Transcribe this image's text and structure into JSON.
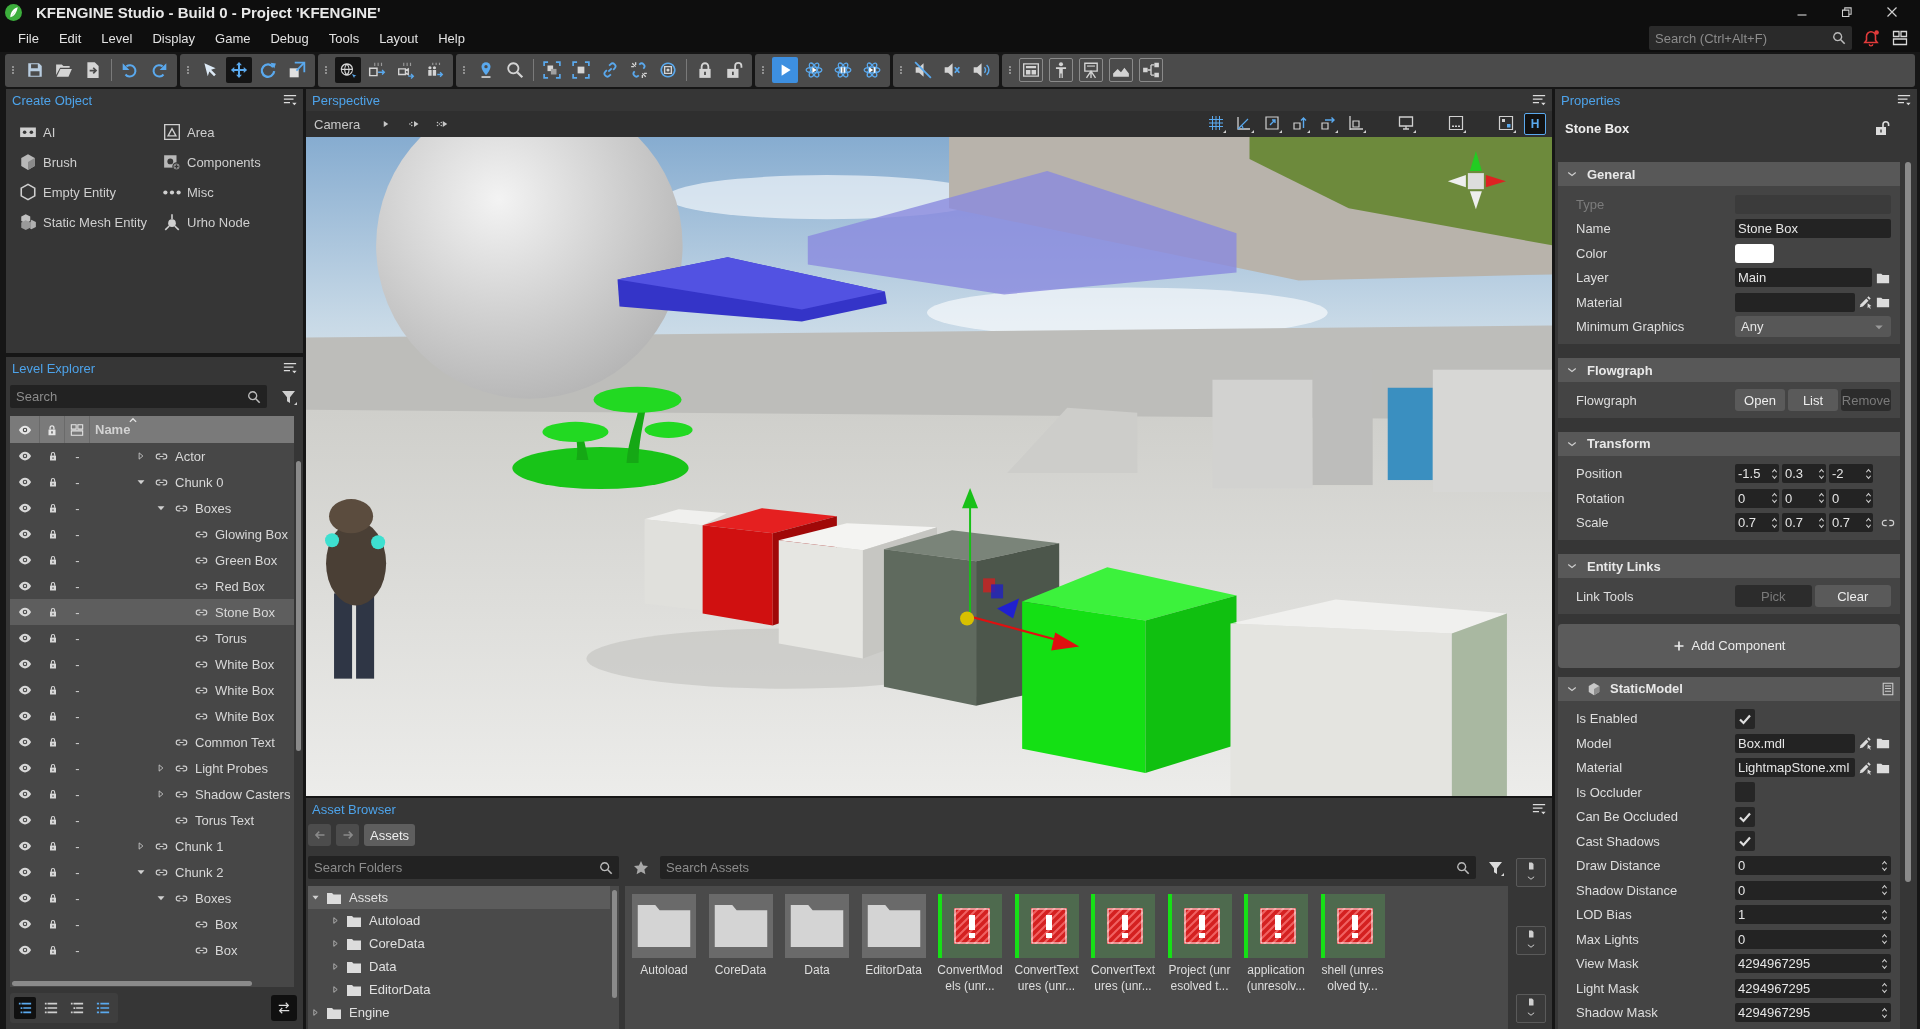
{
  "window": {
    "title": "KFENGINE Studio - Build 0 - Project 'KFENGINE'"
  },
  "menu": [
    {
      "label": "File"
    },
    {
      "label": "Edit"
    },
    {
      "label": "Level"
    },
    {
      "label": "Display"
    },
    {
      "label": "Game"
    },
    {
      "label": "Debug"
    },
    {
      "label": "Tools"
    },
    {
      "label": "Layout"
    },
    {
      "label": "Help"
    }
  ],
  "global_search": {
    "placeholder": "Search (Ctrl+Alt+F)"
  },
  "toolbar": [
    {
      "kind": "tools",
      "sections": [
        [
          {
            "kind": "save",
            "selected": false
          },
          {
            "kind": "open",
            "selected": false
          },
          {
            "kind": "export",
            "selected": false
          }
        ],
        [
          {
            "kind": "undo",
            "selected": false
          },
          {
            "kind": "redo",
            "selected": false
          }
        ]
      ]
    },
    {
      "kind": "tools",
      "sections": [
        [
          {
            "kind": "select",
            "selected": false
          },
          {
            "kind": "move",
            "selected": true
          },
          {
            "kind": "rotate",
            "selected": false
          },
          {
            "kind": "scale",
            "selected": false
          }
        ]
      ]
    },
    {
      "kind": "tools",
      "sections": [
        [
          {
            "kind": "world",
            "selected": true
          },
          {
            "kind": "snap-box",
            "selected": false
          },
          {
            "kind": "snap-camera",
            "selected": false
          },
          {
            "kind": "snap-people",
            "selected": false
          }
        ]
      ]
    },
    {
      "kind": "tools",
      "sections": [
        [
          {
            "kind": "pin",
            "selected": false
          },
          {
            "kind": "zoom",
            "selected": false
          }
        ],
        [
          {
            "kind": "frame-all",
            "selected": false
          },
          {
            "kind": "frame",
            "selected": false
          },
          {
            "kind": "link",
            "selected": false
          },
          {
            "kind": "unlink",
            "selected": false
          },
          {
            "kind": "target",
            "selected": false
          }
        ],
        [
          {
            "kind": "lock",
            "selected": false
          },
          {
            "kind": "unlock",
            "selected": false
          }
        ]
      ]
    },
    {
      "kind": "playback",
      "sections": [
        [
          {
            "kind": "play",
            "selected": true
          },
          {
            "kind": "sim-play",
            "selected": false
          },
          {
            "kind": "sim-pause",
            "selected": false
          },
          {
            "kind": "sim-step",
            "selected": false
          }
        ]
      ]
    },
    {
      "kind": "tools",
      "sections": [
        [
          {
            "kind": "mute",
            "selected": false
          },
          {
            "kind": "mute-x",
            "selected": false
          },
          {
            "kind": "sound",
            "selected": false
          }
        ]
      ]
    },
    {
      "kind": "panels",
      "sections": [
        [
          {
            "kind": "layout",
            "selected": false
          },
          {
            "kind": "person",
            "selected": false
          },
          {
            "kind": "presenter",
            "selected": false
          },
          {
            "kind": "terrain",
            "selected": false
          },
          {
            "kind": "nodes",
            "selected": false
          }
        ]
      ]
    }
  ],
  "create_object": {
    "title": "Create Object",
    "items": [
      {
        "label": "AI",
        "kind": "ai"
      },
      {
        "label": "Area",
        "kind": "area"
      },
      {
        "label": "Brush",
        "kind": "brush"
      },
      {
        "label": "Components",
        "kind": "components"
      },
      {
        "label": "Empty Entity",
        "kind": "entity"
      },
      {
        "label": "Misc",
        "kind": "misc"
      },
      {
        "label": "Static Mesh Entity",
        "kind": "mesh"
      },
      {
        "label": "Urho Node",
        "kind": "node"
      }
    ]
  },
  "level_explorer": {
    "title": "Level Explorer",
    "search": {
      "placeholder": "Search"
    },
    "name_column": "Name",
    "tree": [
      {
        "name": "Actor",
        "layer": "-",
        "kind": "group",
        "expanded": false,
        "selected": false
      },
      {
        "name": "Chunk 0",
        "layer": "-",
        "kind": "group",
        "expanded": true,
        "selected": false,
        "children": [
          {
            "name": "Boxes",
            "layer": "-",
            "kind": "group",
            "expanded": true,
            "selected": false,
            "children": [
              {
                "name": "Glowing Box",
                "layer": "-",
                "kind": "item",
                "selected": false
              },
              {
                "name": "Green Box",
                "layer": "-",
                "kind": "item",
                "selected": false
              },
              {
                "name": "Red Box",
                "layer": "-",
                "kind": "item",
                "selected": false
              },
              {
                "name": "Stone Box",
                "layer": "-",
                "kind": "item",
                "selected": true
              },
              {
                "name": "Torus",
                "layer": "-",
                "kind": "item",
                "selected": false
              },
              {
                "name": "White Box",
                "layer": "-",
                "kind": "item",
                "selected": false
              },
              {
                "name": "White Box",
                "layer": "-",
                "kind": "item",
                "selected": false
              },
              {
                "name": "White Box",
                "layer": "-",
                "kind": "item",
                "selected": false
              }
            ]
          },
          {
            "name": "Common Text",
            "layer": "-",
            "kind": "item",
            "selected": false
          },
          {
            "name": "Light Probes",
            "layer": "-",
            "kind": "group",
            "expanded": false,
            "selected": false
          },
          {
            "name": "Shadow Casters",
            "layer": "-",
            "kind": "group",
            "expanded": false,
            "selected": false
          },
          {
            "name": "Torus Text",
            "layer": "-",
            "kind": "item",
            "selected": false
          }
        ]
      },
      {
        "name": "Chunk 1",
        "layer": "-",
        "kind": "group",
        "expanded": false,
        "selected": false
      },
      {
        "name": "Chunk 2",
        "layer": "-",
        "kind": "group",
        "expanded": true,
        "selected": false,
        "children": [
          {
            "name": "Boxes",
            "layer": "-",
            "kind": "group",
            "expanded": true,
            "selected": false,
            "children": [
              {
                "name": "Box",
                "layer": "-",
                "kind": "item",
                "selected": false
              },
              {
                "name": "Box",
                "layer": "-",
                "kind": "item",
                "selected": false
              }
            ]
          }
        ]
      }
    ],
    "view_modes": [
      {
        "kind": "list-tree",
        "selected": true
      },
      {
        "kind": "list-flat",
        "selected": false
      },
      {
        "kind": "list-layers",
        "selected": false
      },
      {
        "kind": "list-types",
        "selected": false
      }
    ]
  },
  "viewport": {
    "title": "Perspective",
    "camera": "Camera",
    "view_groups": [
      [
        {
          "kind": "grid",
          "selected": false
        },
        {
          "kind": "angle-snap",
          "selected": false
        },
        {
          "kind": "scale-snap",
          "selected": false
        },
        {
          "kind": "raise",
          "selected": false
        },
        {
          "kind": "push",
          "selected": false
        },
        {
          "kind": "align",
          "selected": false
        }
      ],
      [
        {
          "kind": "monitor",
          "selected": false
        }
      ],
      [
        {
          "kind": "display",
          "selected": false
        }
      ],
      [
        {
          "kind": "hud-grid",
          "selected": false
        },
        {
          "kind": "hud",
          "label": "H",
          "selected": true
        }
      ]
    ]
  },
  "asset_browser": {
    "title": "Asset Browser",
    "nav": [
      {
        "kind": "back",
        "disabled": true
      },
      {
        "kind": "forward",
        "disabled": true
      }
    ],
    "path": [
      {
        "label": "Assets"
      }
    ],
    "folder_search": {
      "placeholder": "Search Folders"
    },
    "folders": [
      {
        "name": "Assets",
        "expanded": true,
        "selected": true,
        "children": [
          {
            "name": "Autoload",
            "expanded": false,
            "selected": false
          },
          {
            "name": "CoreData",
            "expanded": false,
            "selected": false
          },
          {
            "name": "Data",
            "expanded": false,
            "selected": false
          },
          {
            "name": "EditorData",
            "expanded": false,
            "selected": false
          }
        ]
      },
      {
        "name": "Engine",
        "expanded": false,
        "selected": false
      }
    ],
    "asset_search": {
      "placeholder": "Search Assets"
    },
    "assets": [
      {
        "name": "Autoload",
        "kind": "folder"
      },
      {
        "name": "CoreData",
        "kind": "folder"
      },
      {
        "name": "Data",
        "kind": "folder"
      },
      {
        "name": "EditorData",
        "kind": "folder"
      },
      {
        "name": "ConvertModels (unr...",
        "kind": "unresolved"
      },
      {
        "name": "ConvertTextures (unr...",
        "kind": "unresolved"
      },
      {
        "name": "ConvertTextures (unr...",
        "kind": "unresolved"
      },
      {
        "name": "Project (unresolved t...",
        "kind": "unresolved"
      },
      {
        "name": "application (unresolv...",
        "kind": "unresolved"
      },
      {
        "name": "shell (unresolved ty...",
        "kind": "unresolved"
      }
    ]
  },
  "properties": {
    "title": "Properties",
    "entity": "Stone Box",
    "sections": [
      {
        "title": "General",
        "expanded": true,
        "rows": [
          {
            "label": "Type",
            "kind": "text",
            "disabled": true
          },
          {
            "label": "Name",
            "kind": "text",
            "value": "Stone Box",
            "disabled": false
          },
          {
            "label": "Color",
            "kind": "color",
            "color": "#ffffff",
            "disabled": false
          },
          {
            "label": "Layer",
            "kind": "folder",
            "value": "Main",
            "disabled": false
          },
          {
            "label": "Material",
            "kind": "asset",
            "disabled": false
          },
          {
            "label": "Minimum Graphics",
            "kind": "dropdown",
            "value": "Any",
            "disabled": false
          }
        ]
      },
      {
        "title": "Flowgraph",
        "expanded": true,
        "rows": [
          {
            "label": "Flowgraph",
            "kind": "buttons",
            "buttons": [
              {
                "label": "Open",
                "disabled": false
              },
              {
                "label": "List",
                "disabled": false
              },
              {
                "label": "Remove",
                "disabled": true
              }
            ]
          }
        ]
      },
      {
        "title": "Transform",
        "expanded": true,
        "rows": [
          {
            "label": "Position",
            "kind": "vector",
            "values": [
              "-1.5",
              "0.3",
              "-2"
            ]
          },
          {
            "label": "Rotation",
            "kind": "vector",
            "values": [
              "0",
              "0",
              "0"
            ]
          },
          {
            "label": "Scale",
            "kind": "scale",
            "values": [
              "0.7",
              "0.7",
              "0.7"
            ]
          }
        ]
      },
      {
        "title": "Entity Links",
        "expanded": true,
        "rows": [
          {
            "label": "Link Tools",
            "kind": "buttons",
            "buttons": [
              {
                "label": "Pick",
                "disabled": true
              },
              {
                "label": "Clear",
                "disabled": false
              }
            ]
          }
        ]
      }
    ],
    "add_component": "Add Component",
    "components": [
      {
        "title": "StaticModel",
        "expanded": true,
        "rows": [
          {
            "label": "Is Enabled",
            "kind": "check",
            "checked": true
          },
          {
            "label": "Model",
            "kind": "asset",
            "value": "Box.mdl"
          },
          {
            "label": "Material",
            "kind": "asset",
            "value": "LightmapStone.xml"
          },
          {
            "label": "Is Occluder",
            "kind": "check",
            "checked": false
          },
          {
            "label": "Can Be Occluded",
            "kind": "check",
            "checked": true
          },
          {
            "label": "Cast Shadows",
            "kind": "check",
            "checked": true
          },
          {
            "label": "Draw Distance",
            "kind": "spin",
            "value": "0"
          },
          {
            "label": "Shadow Distance",
            "kind": "spin",
            "value": "0"
          },
          {
            "label": "LOD Bias",
            "kind": "spin",
            "value": "1"
          },
          {
            "label": "Max Lights",
            "kind": "spin",
            "value": "0"
          },
          {
            "label": "View Mask",
            "kind": "spin",
            "value": "4294967295"
          },
          {
            "label": "Light Mask",
            "kind": "spin",
            "value": "4294967295"
          },
          {
            "label": "Shadow Mask",
            "kind": "spin",
            "value": "4294967295"
          }
        ]
      }
    ]
  }
}
